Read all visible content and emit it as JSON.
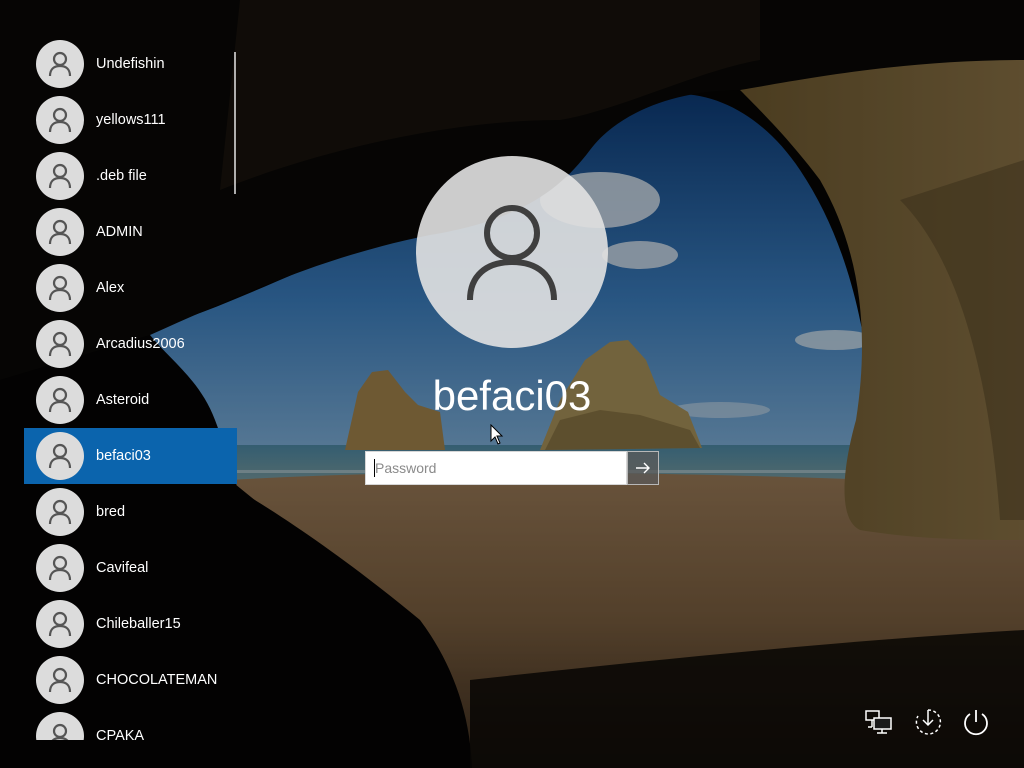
{
  "colors": {
    "selected_highlight": "#0b64ad",
    "avatar_background": "#dcdcdc",
    "text": "#ffffff"
  },
  "users": [
    {
      "name": "Undefishin",
      "selected": false
    },
    {
      "name": "yellows111",
      "selected": false
    },
    {
      "name": ".deb file",
      "selected": false
    },
    {
      "name": "ADMIN",
      "selected": false
    },
    {
      "name": "Alex",
      "selected": false
    },
    {
      "name": "Arcadius2006",
      "selected": false
    },
    {
      "name": "Asteroid",
      "selected": false
    },
    {
      "name": "befaci03",
      "selected": true
    },
    {
      "name": "bred",
      "selected": false
    },
    {
      "name": "Cavifeal",
      "selected": false
    },
    {
      "name": "Chileballer15",
      "selected": false
    },
    {
      "name": "CHOCOLATEMAN",
      "selected": false
    },
    {
      "name": "CPAKA",
      "selected": false
    }
  ],
  "login": {
    "username": "befaci03",
    "password_placeholder": "Password",
    "password_value": "",
    "submit_icon": "arrow-right-icon"
  },
  "corner_controls": {
    "network_icon": "network-icon",
    "ease_of_access_icon": "ease-of-access-icon",
    "power_icon": "power-icon"
  }
}
